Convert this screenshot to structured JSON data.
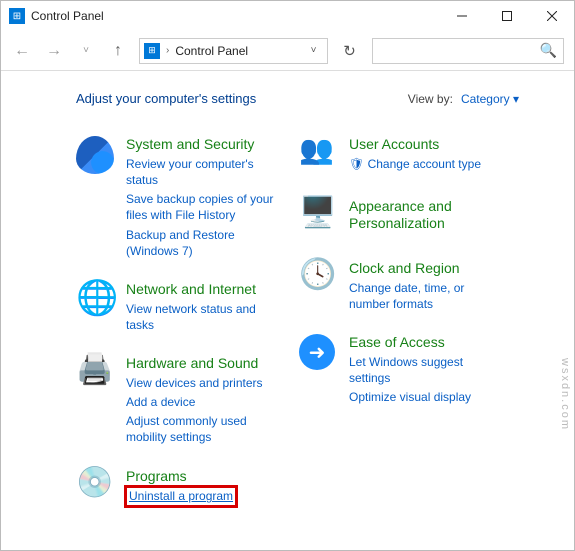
{
  "title": "Control Panel",
  "breadcrumb": "Control Panel",
  "heading": "Adjust your computer's settings",
  "viewby": {
    "label": "View by:",
    "value": "Category"
  },
  "watermark": "wsxdn.com",
  "left": {
    "c0": {
      "title": "System and Security",
      "l0": "Review your computer's status",
      "l1": "Save backup copies of your files with File History",
      "l2": "Backup and Restore (Windows 7)"
    },
    "c1": {
      "title": "Network and Internet",
      "l0": "View network status and tasks"
    },
    "c2": {
      "title": "Hardware and Sound",
      "l0": "View devices and printers",
      "l1": "Add a device",
      "l2": "Adjust commonly used mobility settings"
    },
    "c3": {
      "title": "Programs",
      "l0": "Uninstall a program"
    }
  },
  "right": {
    "c0": {
      "title": "User Accounts",
      "l0": "Change account type"
    },
    "c1": {
      "title": "Appearance and Personalization"
    },
    "c2": {
      "title": "Clock and Region",
      "l0": "Change date, time, or number formats"
    },
    "c3": {
      "title": "Ease of Access",
      "l0": "Let Windows suggest settings",
      "l1": "Optimize visual display"
    }
  }
}
